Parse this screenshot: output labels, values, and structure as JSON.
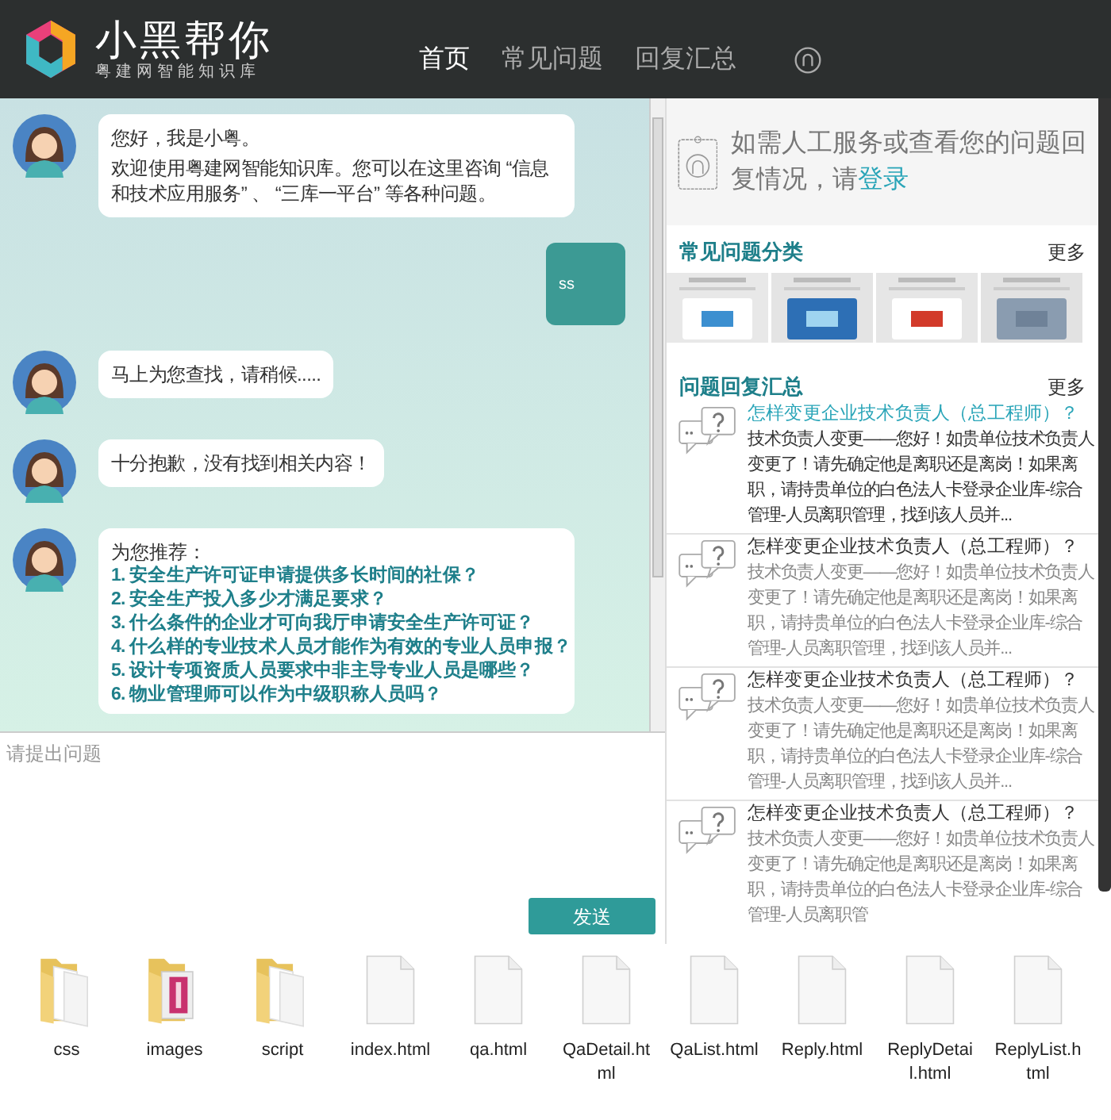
{
  "header": {
    "logo_title": "小黑帮你",
    "logo_subtitle": "粤建网智能知识库",
    "nav": [
      {
        "label": "首页",
        "selected": true
      },
      {
        "label": "常见问题",
        "selected": false
      },
      {
        "label": "回复汇总",
        "selected": false
      }
    ]
  },
  "chat": {
    "messages": [
      {
        "kind": "bot",
        "paragraphs": [
          "您好，我是小粤。",
          "欢迎使用粤建网智能知识库。您可以在这里咨询 “信息和技术应用服务” 、 “三库一平台” 等各种问题。"
        ]
      },
      {
        "kind": "user",
        "paragraphs": [
          "ss"
        ]
      },
      {
        "kind": "bot",
        "paragraphs": [
          "马上为您查找，请稍候....."
        ]
      },
      {
        "kind": "bot",
        "paragraphs": [
          "十分抱歉，没有找到相关内容！"
        ]
      },
      {
        "kind": "recommend",
        "intro": "为您推荐：",
        "links": [
          "1. 安全生产许可证申请提供多长时间的社保？",
          "2. 安全生产投入多少才满足要求？",
          "3. 什么条件的企业才可向我厅申请安全生产许可证？",
          "4. 什么样的专业技术人员才能作为有效的专业人员申报？",
          "5. 设计专项资质人员要求中非主导专业人员是哪些？",
          "6. 物业管理师可以作为中级职称人员吗？"
        ]
      }
    ],
    "input": {
      "placeholder": "请提出问题"
    },
    "send_button": "发送"
  },
  "sidebar": {
    "login_prompt": "如需人工服务或查看您的问题回复情况，请",
    "login_link": "登录",
    "categories": {
      "title": "常见问题分类",
      "more": "更多"
    },
    "replies": {
      "title": "问题回复汇总",
      "more": "更多",
      "items": [
        {
          "title": "怎样变更企业技术负责人（总工程师）？",
          "body": "技术负责人变更——您好！如贵单位技术负责人变更了！请先确定他是离职还是离岗！如果离职，请持贵单位的白色法人卡登录企业库-综合管理-人员离职管理，找到该人员并...",
          "selected": true
        },
        {
          "title": "怎样变更企业技术负责人（总工程师）？",
          "body": "技术负责人变更——您好！如贵单位技术负责人变更了！请先确定他是离职还是离岗！如果离职，请持贵单位的白色法人卡登录企业库-综合管理-人员离职管理，找到该人员并...",
          "selected": false
        },
        {
          "title": "怎样变更企业技术负责人（总工程师）？",
          "body": "技术负责人变更——您好！如贵单位技术负责人变更了！请先确定他是离职还是离岗！如果离职，请持贵单位的白色法人卡登录企业库-综合管理-人员离职管理，找到该人员并...",
          "selected": false
        },
        {
          "title": "怎样变更企业技术负责人（总工程师）？",
          "body": "技术负责人变更——您好！如贵单位技术负责人变更了！请先确定他是离职还是离岗！如果离职，请持贵单位的白色法人卡登录企业库-综合管理-人员离职管",
          "selected": false
        }
      ]
    }
  },
  "files": [
    {
      "kind": "folder",
      "name": "css"
    },
    {
      "kind": "image_folder",
      "name": "images"
    },
    {
      "kind": "folder",
      "name": "script"
    },
    {
      "kind": "file",
      "name": "index.html"
    },
    {
      "kind": "file",
      "name": "qa.html"
    },
    {
      "kind": "file",
      "name": "QaDetail.html"
    },
    {
      "kind": "file",
      "name": "QaList.html"
    },
    {
      "kind": "file",
      "name": "Reply.html"
    },
    {
      "kind": "file",
      "name": "ReplyDetail.html"
    },
    {
      "kind": "file",
      "name": "ReplyList.html"
    }
  ]
}
